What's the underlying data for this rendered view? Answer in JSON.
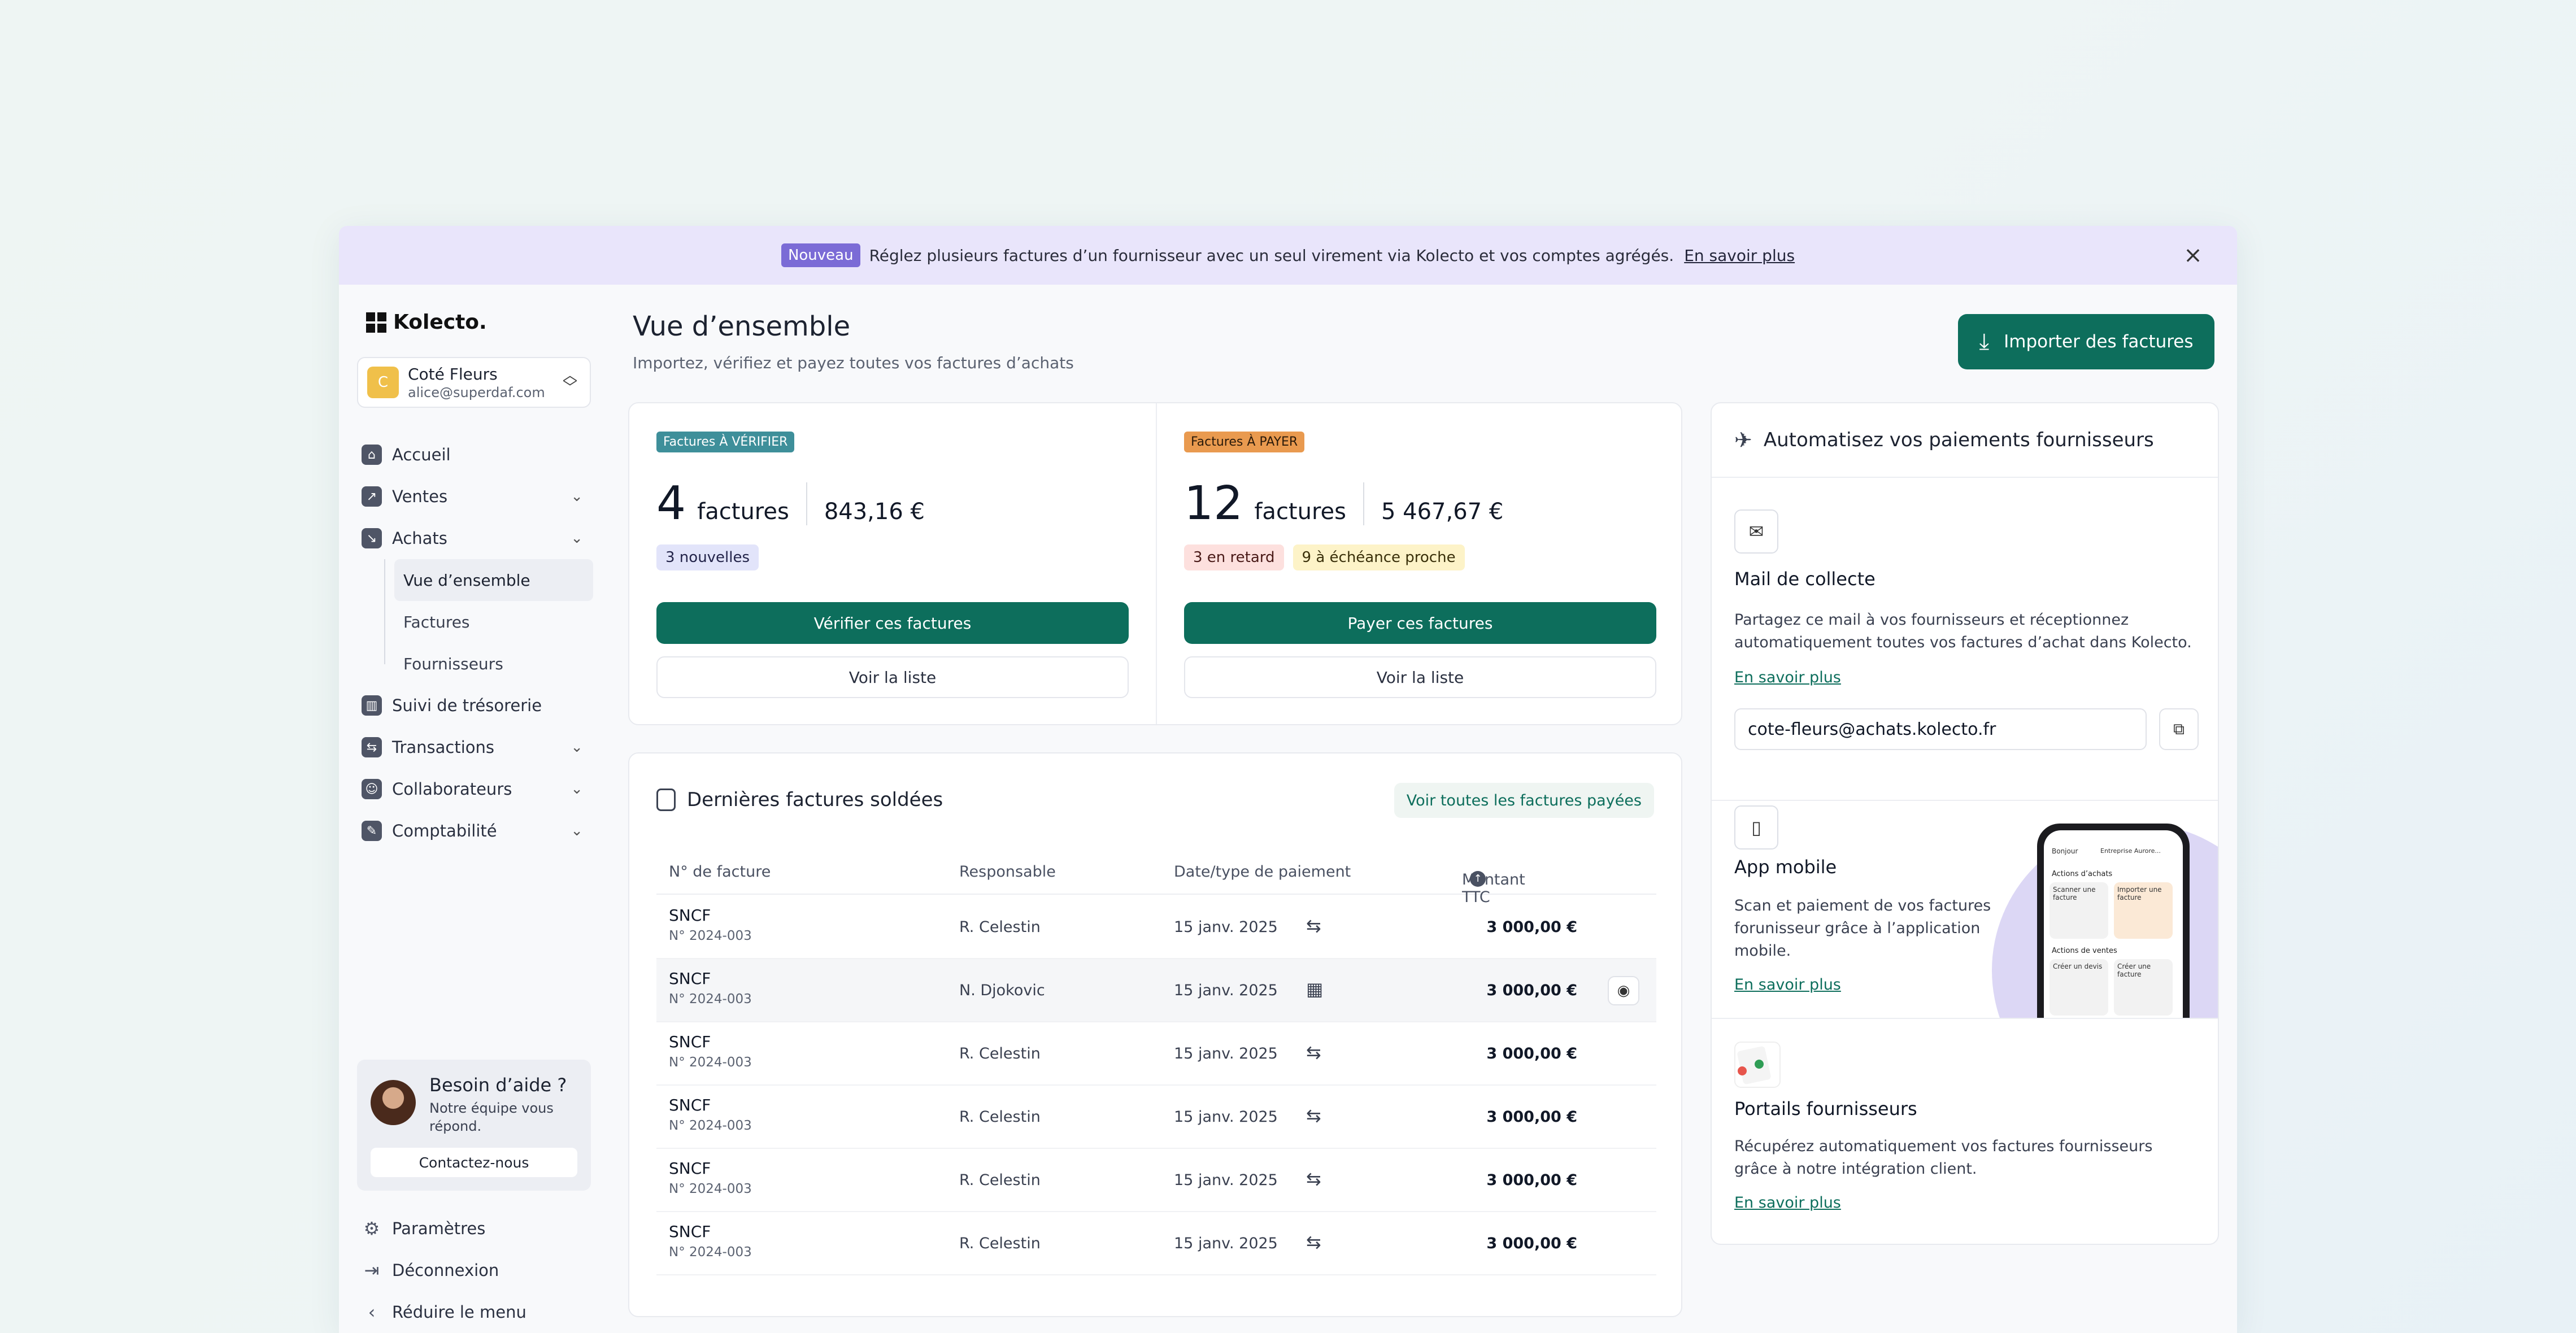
{
  "banner": {
    "badge": "Nouveau",
    "text": "Réglez plusieurs factures d’un fournisseur avec un seul virement via Kolecto et vos comptes agrégés.",
    "link": "En savoir plus"
  },
  "sidebar": {
    "logo": "Kolecto.",
    "account": {
      "initial": "C",
      "name": "Coté Fleurs",
      "email": "alice@superdaf.com"
    },
    "nav": [
      {
        "label": "Accueil",
        "icon": "home-icon"
      },
      {
        "label": "Ventes",
        "icon": "sales-arrow-icon"
      },
      {
        "label": "Achats",
        "icon": "purchases-arrow-icon"
      }
    ],
    "achats_sub": [
      "Vue d’ensemble",
      "Factures",
      "Fournisseurs"
    ],
    "nav2": [
      {
        "label": "Suivi de trésorerie",
        "icon": "chart-bars-icon"
      },
      {
        "label": "Transactions",
        "icon": "transfer-icon"
      },
      {
        "label": "Collaborateurs",
        "icon": "users-icon"
      },
      {
        "label": "Comptabilité",
        "icon": "accounting-icon"
      }
    ],
    "help": {
      "title": "Besoin d’aide ?",
      "text": "Notre équipe vous répond.",
      "button": "Contactez-nous"
    },
    "footer": [
      "Paramètres",
      "Déconnexion",
      "Réduire le menu"
    ]
  },
  "header": {
    "title": "Vue d’ensemble",
    "subtitle": "Importez, vérifiez et payez toutes vos factures d’achats",
    "import_button": "Importer des factures"
  },
  "to_verify": {
    "tag": "Factures À VÉRIFIER",
    "count": "4",
    "unit": "factures",
    "amount": "843,16 €",
    "pill": "3 nouvelles",
    "primary": "Vérifier ces factures",
    "secondary": "Voir la liste"
  },
  "to_pay": {
    "tag": "Factures À PAYER",
    "count": "12",
    "unit": "factures",
    "amount": "5 467,67 €",
    "pill_late": "3 en retard",
    "pill_due": "9 à échéance proche",
    "primary": "Payer ces factures",
    "secondary": "Voir la liste"
  },
  "paid": {
    "title": "Dernières factures soldées",
    "link": "Voir toutes les factures payées",
    "columns": [
      "N° de facture",
      "Responsable",
      "Date/type de paiement",
      "Montant TTC"
    ],
    "rows": [
      {
        "supplier": "SNCF",
        "number": "N° 2024-003",
        "owner": "R. Celestin",
        "date": "15 janv. 2025",
        "type_icon": "transfer-icon",
        "type_glyph": "⇆",
        "amount": "3 000,00 €"
      },
      {
        "supplier": "SNCF",
        "number": "N° 2024-003",
        "owner": "N. Djokovic",
        "date": "15 janv. 2025",
        "type_icon": "calendar-icon",
        "type_glyph": "▦",
        "amount": "3 000,00 €"
      },
      {
        "supplier": "SNCF",
        "number": "N° 2024-003",
        "owner": "R. Celestin",
        "date": "15 janv. 2025",
        "type_icon": "transfer-icon",
        "type_glyph": "⇆",
        "amount": "3 000,00 €"
      },
      {
        "supplier": "SNCF",
        "number": "N° 2024-003",
        "owner": "R. Celestin",
        "date": "15 janv. 2025",
        "type_icon": "transfer-icon",
        "type_glyph": "⇆",
        "amount": "3 000,00 €"
      },
      {
        "supplier": "SNCF",
        "number": "N° 2024-003",
        "owner": "R. Celestin",
        "date": "15 janv. 2025",
        "type_icon": "transfer-icon",
        "type_glyph": "⇆",
        "amount": "3 000,00 €"
      },
      {
        "supplier": "SNCF",
        "number": "N° 2024-003",
        "owner": "R. Celestin",
        "date": "15 janv. 2025",
        "type_icon": "transfer-icon",
        "type_glyph": "⇆",
        "amount": "3 000,00 €"
      }
    ]
  },
  "automation": {
    "title": "Automatisez vos paiements fournisseurs",
    "mail": {
      "title": "Mail de collecte",
      "text": "Partagez ce mail à vos fournisseurs  et réceptionnez automatiquement toutes vos factures d’achat dans Kolecto.",
      "link": "En savoir plus",
      "email": "cote-fleurs@achats.kolecto.fr"
    },
    "app": {
      "title": "App mobile",
      "text": "Scan et paiement de vos factures forunisseur grâce à l’application mobile.",
      "link": "En savoir plus",
      "phone": {
        "greeting": "Bonjour",
        "company": "Entreprise Aurore...",
        "section1": "Actions d’achats",
        "t1": "Scanner une facture",
        "t2": "Importer une facture",
        "section2": "Actions de ventes",
        "t3": "Créer un devis",
        "t4": "Créer une facture"
      }
    },
    "portals": {
      "title": "Portails fournisseurs",
      "text": "Récupérez automatiquement vos factures fournisseurs grâce à notre intégration client.",
      "link": "En savoir plus"
    }
  },
  "colors": {
    "brand_green": "#0d6e5c",
    "banner_bg": "#e9e5fb",
    "badge_purple": "#7b6bd6"
  }
}
